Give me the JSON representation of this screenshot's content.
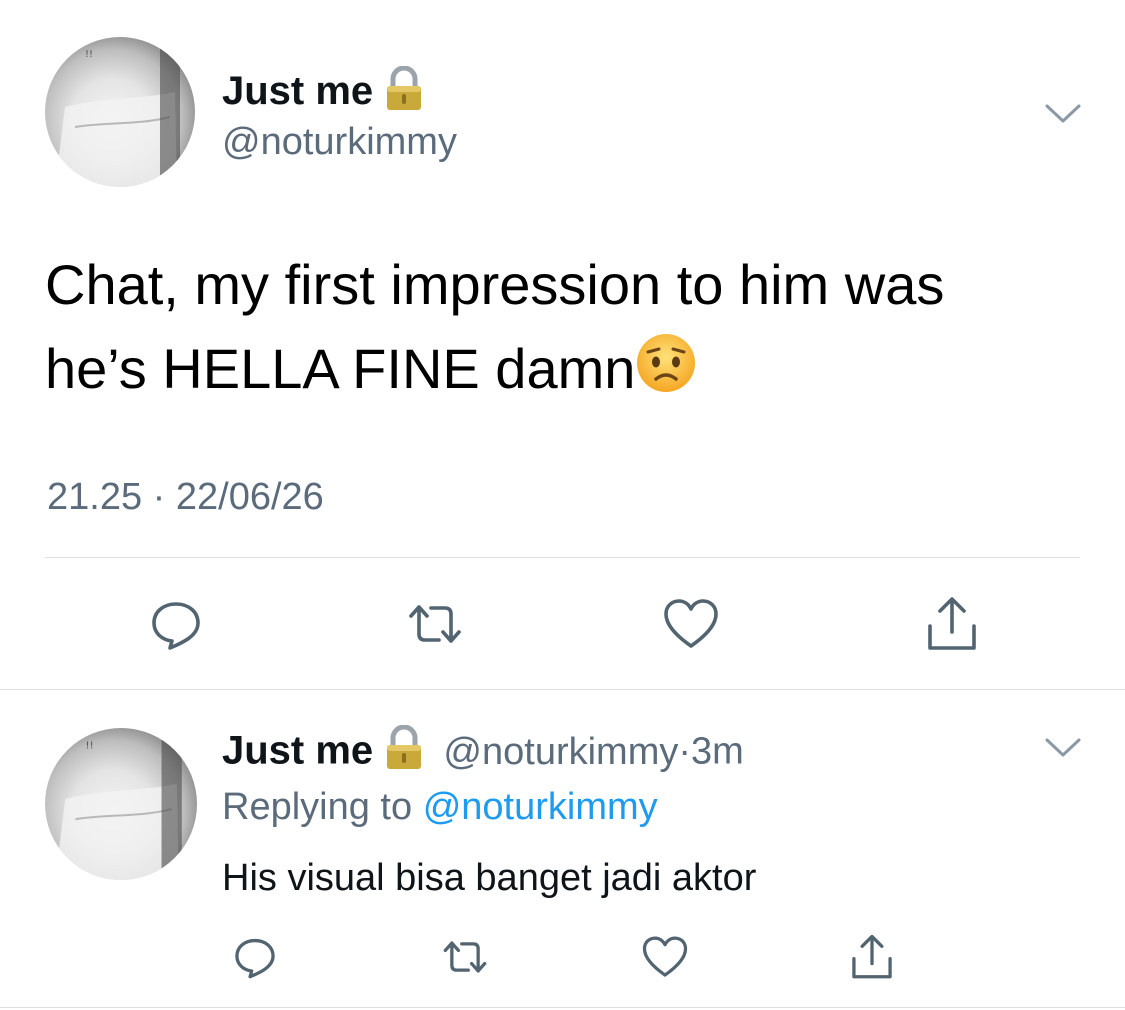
{
  "main_tweet": {
    "author": {
      "display_name": "Just me",
      "handle": "@noturkimmy",
      "protected_icon": "lock-icon",
      "avatar_icon": "profile-photo"
    },
    "text_line1": "Chat, my first impression to him was",
    "text_line2": "he’s HELLA FINE damn",
    "emoji_icon": "worried-face-emoji",
    "time": "21.25",
    "separator": "·",
    "date": "22/06/26",
    "menu_icon": "chevron-down-icon",
    "actions": [
      {
        "name": "reply",
        "icon": "reply-icon"
      },
      {
        "name": "retweet",
        "icon": "retweet-icon"
      },
      {
        "name": "like",
        "icon": "heart-icon"
      },
      {
        "name": "share",
        "icon": "share-icon"
      }
    ]
  },
  "reply_tweet": {
    "author": {
      "display_name": "Just me",
      "handle": "@noturkimmy",
      "protected_icon": "lock-icon"
    },
    "separator": "·",
    "age": "3m",
    "replying_to_label": "Replying to",
    "replying_to_handle": "@noturkimmy",
    "text": "His visual bisa banget jadi aktor",
    "menu_icon": "chevron-down-icon"
  },
  "colors": {
    "text": "#000000",
    "muted": "#5b6b7b",
    "link": "#1d9bf0",
    "divider": "#dcdfe3",
    "icon": "#536471",
    "lock_gold": "#c9a93a"
  }
}
